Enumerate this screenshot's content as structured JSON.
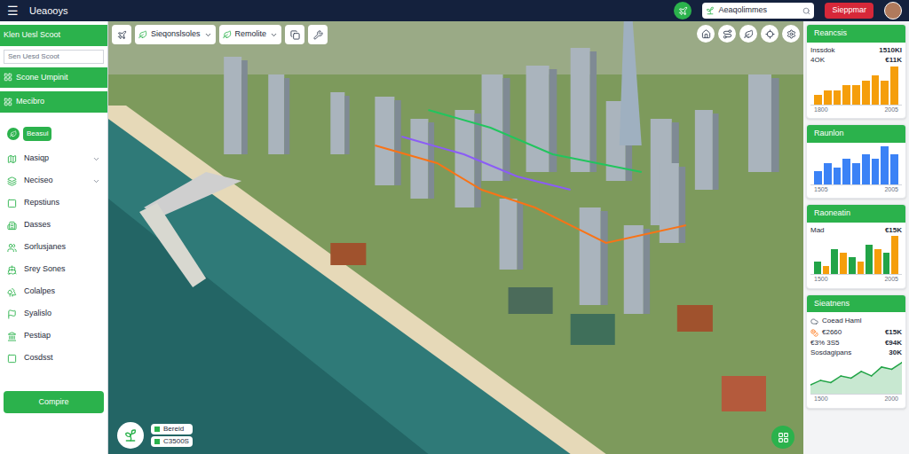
{
  "window": {
    "title": "Ueaooys",
    "menu_icon": "☰"
  },
  "top_bar": {
    "search": {
      "value": "Aeaqolimmes"
    },
    "button": "Sieppmar"
  },
  "sidebar": {
    "title": "Klen Uesl Scoot",
    "search": {
      "placeholder": "Sen Uesd Scoot"
    },
    "primary": [
      {
        "label": "Scone Umpinit"
      },
      {
        "label": "Mecibro"
      }
    ],
    "badge": "Beasul",
    "items": [
      {
        "label": "Nasiqp",
        "expandable": true
      },
      {
        "label": "Neciseo",
        "expandable": true
      },
      {
        "label": "Repstiuns",
        "expandable": false
      },
      {
        "label": "Dasses",
        "expandable": false
      },
      {
        "label": "Sorlusjanes",
        "expandable": false
      },
      {
        "label": "Srey Sones",
        "expandable": false
      },
      {
        "label": "Colalpes",
        "expandable": false
      },
      {
        "label": "Syalislo",
        "expandable": false
      },
      {
        "label": "Pestiap",
        "expandable": false
      },
      {
        "label": "Cosdsst",
        "expandable": false
      }
    ],
    "button": "Compire"
  },
  "map_toolbar": {
    "dropdowns": [
      "Sieqonslsoles",
      "Remolite"
    ]
  },
  "map_info": {
    "title": "Bereid",
    "value": "C3500S"
  },
  "panels": [
    {
      "title": "Reancsis",
      "rows": [
        {
          "label": "Inssdok",
          "value": "1510KI"
        },
        {
          "label": "4OK",
          "value": "€11K"
        }
      ],
      "chart": {
        "type": "bar",
        "series": [
          {
            "values": [
              2,
              3,
              3,
              4,
              4,
              5,
              6,
              5,
              8
            ],
            "color": "#f59e0b"
          }
        ],
        "ticks": [
          "1800",
          "2005"
        ]
      }
    },
    {
      "title": "Raunlon",
      "rows": [],
      "chart": {
        "type": "bar",
        "series": [
          {
            "values": [
              3,
              5,
              4,
              6,
              5,
              7,
              6,
              9,
              7
            ],
            "color": "#3b82f6"
          }
        ],
        "ticks": [
          "1505",
          "2005"
        ]
      }
    },
    {
      "title": "Raoneatin",
      "rows": [
        {
          "label": "Mad",
          "value": "€15K"
        }
      ],
      "chart": {
        "type": "bar",
        "series": [
          {
            "values": [
              3,
              6,
              4,
              7,
              5
            ],
            "color": "#22a447"
          },
          {
            "values": [
              2,
              5,
              3,
              6,
              9
            ],
            "color": "#f59e0b"
          }
        ],
        "ticks": [
          "1500",
          "2005"
        ]
      }
    },
    {
      "title": "Sieatnens",
      "subtitle": "Coead Haml",
      "rows": [
        {
          "label": "€2660",
          "value": "€15K"
        },
        {
          "label": "€3% 3S5",
          "value": "€94K"
        },
        {
          "label": "Sosdagipans",
          "value": "30K"
        }
      ],
      "chart": {
        "type": "area",
        "series": [
          {
            "values": [
              2,
              3,
              2.5,
              4,
              3.5,
              5,
              4,
              6,
              5.5,
              7
            ],
            "color": "#22a447"
          }
        ],
        "ticks": [
          "1500",
          "2000"
        ]
      }
    }
  ]
}
